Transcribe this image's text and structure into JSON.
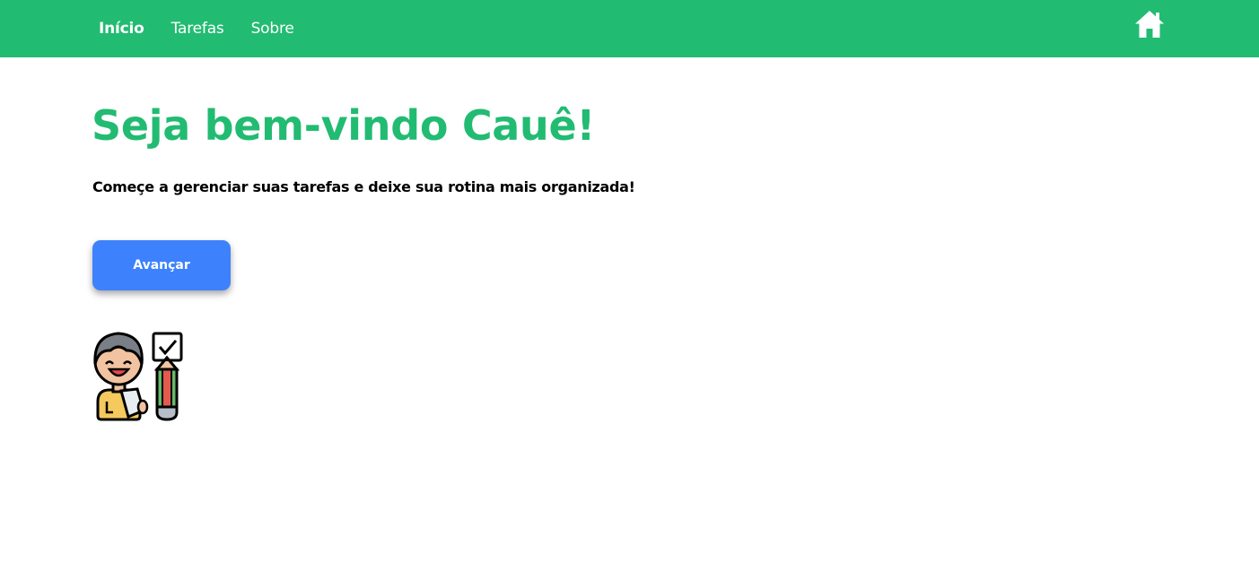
{
  "nav": {
    "links": [
      {
        "label": "Início",
        "active": true
      },
      {
        "label": "Tarefas",
        "active": false
      },
      {
        "label": "Sobre",
        "active": false
      }
    ],
    "home_icon": "home-icon"
  },
  "main": {
    "title": "Seja bem-vindo Cauê!",
    "subtitle": "Começe a gerenciar suas tarefas e deixe sua rotina mais organizada!",
    "button_label": "Avançar",
    "illustration": "person-with-checklist-and-pencil-illustration"
  },
  "colors": {
    "primary_green": "#22bb72",
    "button_blue": "#3d82fc",
    "text": "#000000",
    "background": "#ffffff"
  }
}
